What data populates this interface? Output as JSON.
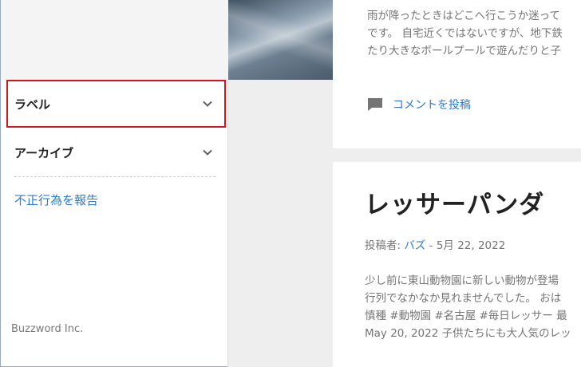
{
  "sidebar": {
    "items": [
      {
        "label": "ラベル"
      },
      {
        "label": "アーカイブ"
      }
    ],
    "report_link": "不正行為を報告",
    "brand": "Buzzword Inc."
  },
  "post1": {
    "snippet_lines": [
      "雨が降ったときはどこへ行こうか迷って",
      "です。 自宅近くではないですが、地下鉄",
      "たり大きなボールプールで遊んだりと子"
    ],
    "comment_label": "コメントを投稿"
  },
  "post2": {
    "title": "レッサーパンダ",
    "byline_prefix": "投稿者:",
    "author": "バズ",
    "byline_sep": "-",
    "date": "5月 22, 2022",
    "snippet_lines": [
      "少し前に東山動物園に新しい動物が登場",
      "行列でなかなか見れませんでした。 おは",
      "慎種 #動物園 #名古屋 #毎日レッサー 最",
      "May 20, 2022 子供たちにも大人気のレッ"
    ]
  },
  "colors": {
    "accent_link": "#2c7bd0",
    "selection_border": "#d0161d",
    "text_dark": "#212121",
    "text_muted": "#757575"
  },
  "icons": {
    "chevron": "chevron-down-icon",
    "comment": "comment-icon"
  }
}
